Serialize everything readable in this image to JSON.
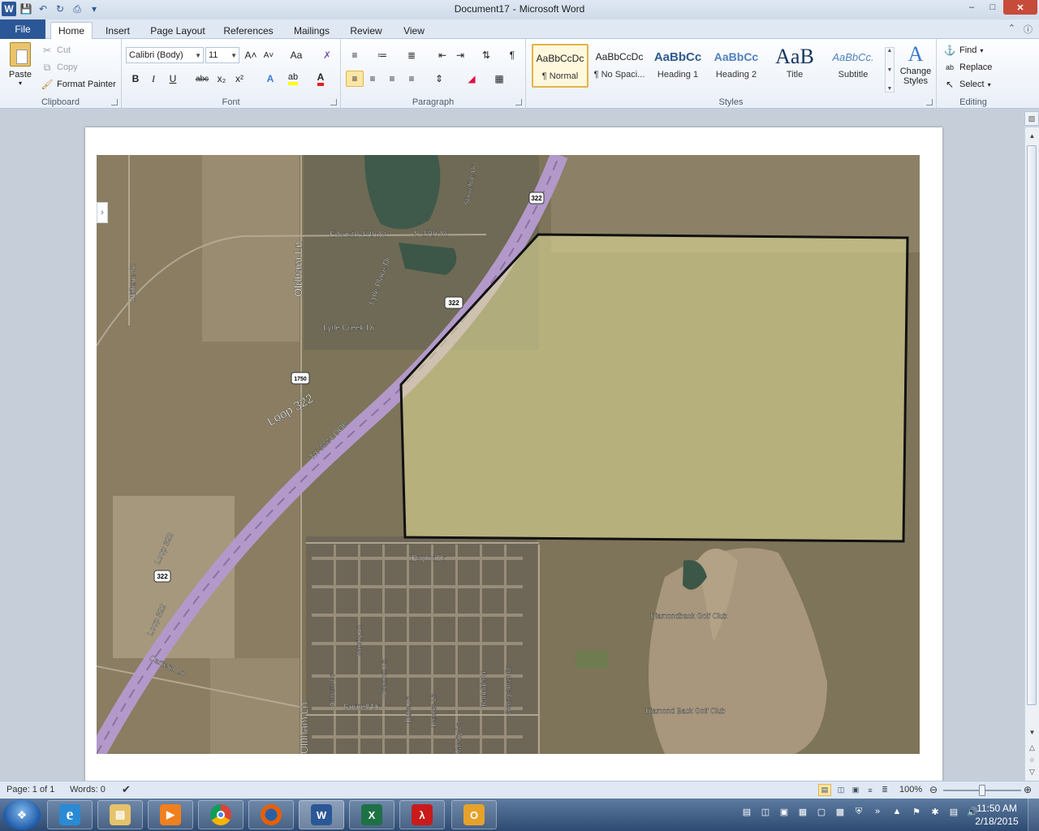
{
  "window": {
    "doc_name": "Document17",
    "separator": "-",
    "app_name": "Microsoft Word",
    "minimize": "–",
    "restore": "□",
    "close": "✕"
  },
  "qat": {
    "save": "💾",
    "undo": "↶",
    "redo": "↻",
    "print": "⎙"
  },
  "tabs": {
    "file": "File",
    "items": [
      "Home",
      "Insert",
      "Page Layout",
      "References",
      "Mailings",
      "Review",
      "View"
    ]
  },
  "clipboard": {
    "label": "Clipboard",
    "paste": "Paste",
    "cut": "Cut",
    "copy": "Copy",
    "format_painter": "Format Painter"
  },
  "font": {
    "label": "Font",
    "family": "Calibri (Body)",
    "size": "11",
    "grow": "A˄",
    "shrink": "A˅",
    "case": "Aa",
    "bold": "B",
    "italic": "I",
    "underline": "U",
    "strike": "abc",
    "subscript": "x₂",
    "superscript": "x²",
    "font_color": "A"
  },
  "paragraph": {
    "label": "Paragraph",
    "pilcrow": "¶"
  },
  "styles": {
    "label": "Styles",
    "items": [
      {
        "sample": "AaBbCcDc",
        "name": "¶ Normal"
      },
      {
        "sample": "AaBbCcDc",
        "name": "¶ No Spaci..."
      },
      {
        "sample": "AaBbCc",
        "name": "Heading 1"
      },
      {
        "sample": "AaBbCc",
        "name": "Heading 2"
      },
      {
        "sample": "AaB",
        "name": "Title"
      },
      {
        "sample": "AaBbCc.",
        "name": "Subtitle"
      }
    ],
    "change_styles_line1": "Change",
    "change_styles_line2": "Styles"
  },
  "editing": {
    "label": "Editing",
    "find": "Find",
    "replace": "Replace",
    "select": "Select"
  },
  "map": {
    "labels": {
      "e_south_27th": "E South 27th St",
      "s_27th": "S 27th St",
      "oldham": "Oldham Ln",
      "oldham_bottom": "Oldham Ln",
      "lytle_place": "Lytle Place Dr",
      "lytle_creek": "Lytle Creek Dr",
      "abilene": "Abilene St",
      "loop_322": "Loop 322",
      "tx_322": "TX 322 LOOP",
      "loop_322_sw1": "Loop 322",
      "loop_322_sw2": "Loop 322",
      "carrera": "Carrera Ln",
      "bay_or": "Bay or Dr",
      "auburn": "Auburn Dr",
      "varsity": "Varsity Ln",
      "scranton": "Scranton Ln",
      "duke": "Duke Ln",
      "purdue": "Purdue Ln",
      "radcliff": "Radcliff Rd",
      "georgetown": "Georgetown Dr",
      "cornell": "Cornell Dr",
      "varsity_bottom": "Varsity Ln",
      "shoreline": "Shoreline Dr",
      "diamondback": "Diamondback Golf Club",
      "diamond_back": "Diamond Back Golf Club"
    },
    "shields": {
      "s322": "322",
      "s1750": "1750"
    }
  },
  "status": {
    "page": "Page: 1 of 1",
    "words": "Words: 0",
    "zoom": "100%",
    "zoom_minus": "⊖",
    "zoom_plus": "⊕"
  },
  "taskbar": {
    "apps": [
      "Internet Explorer",
      "Windows Explorer",
      "Media Player",
      "Chrome",
      "Firefox",
      "Word",
      "Excel",
      "Adobe Reader",
      "Outlook"
    ],
    "time": "11:50 AM",
    "date": "2/18/2015"
  },
  "colors": {
    "accent": "#2b5797",
    "overlay_fill": "#e6e29a",
    "boundary": "#111111",
    "highway": "#b299c9"
  }
}
